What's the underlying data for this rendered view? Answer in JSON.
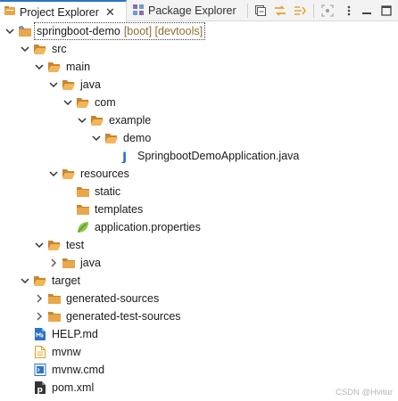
{
  "tabs": {
    "project_explorer": "Project Explorer",
    "project_explorer_close": "✕",
    "package_explorer": "Package Explorer"
  },
  "toolbar": {
    "icons": [
      "collapse-all-icon",
      "link-with-editor-icon",
      "filter-icon",
      "focus-icon",
      "view-menu-icon",
      "minimize-icon",
      "maximize-icon"
    ]
  },
  "tree": {
    "project": {
      "label": "springboot-demo",
      "decorations": "[boot] [devtools]"
    },
    "src": "src",
    "main": "main",
    "java": "java",
    "com": "com",
    "example": "example",
    "demo": "demo",
    "app_file": "SpringbootDemoApplication.java",
    "resources": "resources",
    "static": "static",
    "templates": "templates",
    "properties": "application.properties",
    "test": "test",
    "test_java": "java",
    "target": "target",
    "generated_sources": "generated-sources",
    "generated_test_sources": "generated-test-sources",
    "help": "HELP.md",
    "mvnw": "mvnw",
    "mvnw_cmd": "mvnw.cmd",
    "pom": "pom.xml"
  },
  "colors": {
    "folder": "#e8a84a",
    "folder_dark": "#c9852b",
    "java_blue": "#2d73c4",
    "accent": "#2d73c4"
  },
  "watermark": "CSDN @Hvitur"
}
